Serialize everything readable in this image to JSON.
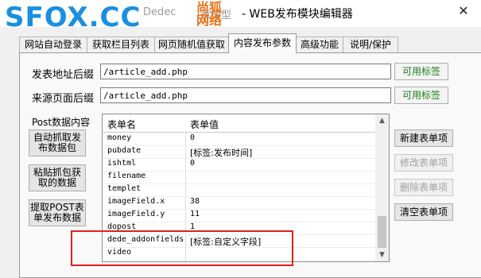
{
  "window": {
    "watermark": "SFOX.CC",
    "watermark_cn_line1": "尚狐",
    "watermark_cn_line2": "网络",
    "title_partial": "Dedec",
    "title_partial2": "章模型",
    "title": "- WEB发布模块编辑器",
    "close_glyph": "✕"
  },
  "tabs": [
    {
      "label": "网站自动登录"
    },
    {
      "label": "获取栏目列表"
    },
    {
      "label": "网页随机值获取"
    },
    {
      "label": "内容发布参数",
      "active": true
    },
    {
      "label": "高级功能"
    },
    {
      "label": "说明/保护"
    }
  ],
  "form": {
    "post_suffix_label": "发表地址后缀",
    "post_suffix_value": "/article_add.php",
    "source_suffix_label": "来源页面后缀",
    "source_suffix_value": "/article_add.php",
    "tags_button": "可用标签",
    "post_data_label": "Post数据内容"
  },
  "left_buttons": {
    "auto_capture": "自动抓取发布数据包",
    "paste_capture": "粘贴抓包获取的数据",
    "extract_post": "提取POST表单发布数据"
  },
  "table": {
    "headers": [
      "表单名",
      "表单值"
    ],
    "rows": [
      {
        "name": "money",
        "value": "0"
      },
      {
        "name": "pubdate",
        "value": "[标签:发布时间]"
      },
      {
        "name": "ishtml",
        "value": "0"
      },
      {
        "name": "filename",
        "value": ""
      },
      {
        "name": "templet",
        "value": ""
      },
      {
        "name": "imageField.x",
        "value": "38"
      },
      {
        "name": "imageField.y",
        "value": "11"
      },
      {
        "name": "dopost",
        "value": "1"
      },
      {
        "name": "dede_addonfields",
        "value": "[标签:自定义字段]"
      },
      {
        "name": "video",
        "value": ""
      }
    ]
  },
  "right_buttons": {
    "new_item": "新建表单项",
    "edit_item": "修改表单项",
    "delete_item": "删除表单项",
    "clear_items": "清空表单项"
  },
  "colors": {
    "watermark_blue": "#1a8fe0",
    "watermark_orange": "#e8731a",
    "highlight_red": "#e02020",
    "tag_button_green": "#1c7f1c"
  }
}
